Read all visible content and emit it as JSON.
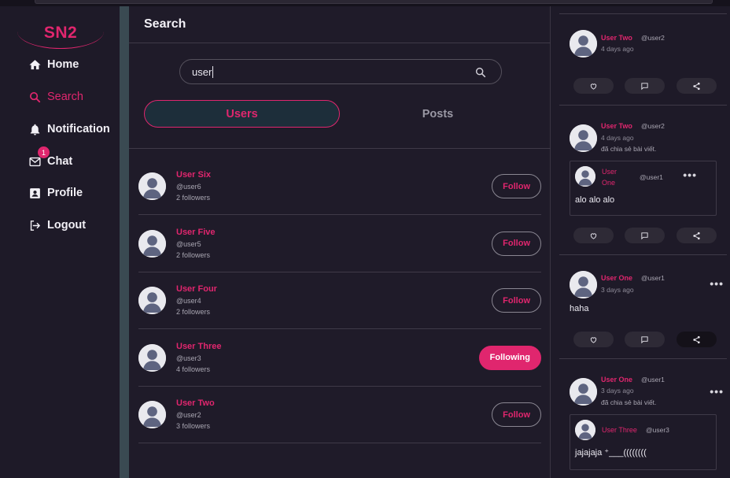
{
  "nav": {
    "logo": "SN2",
    "items": [
      {
        "label": "Home",
        "icon": "home-icon"
      },
      {
        "label": "Search",
        "icon": "search-icon",
        "active": true
      },
      {
        "label": "Notification",
        "icon": "bell-icon"
      },
      {
        "label": "Chat",
        "icon": "mail-icon",
        "badge": "1"
      },
      {
        "label": "Profile",
        "icon": "profile-card-icon"
      },
      {
        "label": "Logout",
        "icon": "logout-icon"
      }
    ]
  },
  "main": {
    "title": "Search",
    "search": {
      "value": "user"
    },
    "tabs": {
      "users": "Users",
      "posts": "Posts"
    },
    "users": [
      {
        "name": "User Six",
        "handle": "@user6",
        "followers": "2 followers",
        "button": "Follow",
        "following": false
      },
      {
        "name": "User Five",
        "handle": "@user5",
        "followers": "2 followers",
        "button": "Follow",
        "following": false
      },
      {
        "name": "User Four",
        "handle": "@user4",
        "followers": "2 followers",
        "button": "Follow",
        "following": false
      },
      {
        "name": "User Three",
        "handle": "@user3",
        "followers": "4 followers",
        "button": "Following",
        "following": true
      },
      {
        "name": "User Two",
        "handle": "@user2",
        "followers": "3 followers",
        "button": "Follow",
        "following": false
      }
    ]
  },
  "feed": {
    "posts": [
      {
        "name": "User Two",
        "handle": "@user2",
        "time": "4 days ago"
      },
      {
        "name": "User Two",
        "handle": "@user2",
        "time": "4 days ago",
        "shared": "đã chia sẻ bài viết.",
        "embed": {
          "name_line1": "User",
          "name_line2": "One",
          "handle": "@user1",
          "text": "alo alo alo"
        }
      },
      {
        "name": "User One",
        "handle": "@user1",
        "time": "3 days ago",
        "text": "haha"
      },
      {
        "name": "User One",
        "handle": "@user1",
        "time": "3 days ago",
        "shared": "đã chia sẻ bài viết.",
        "embed": {
          "name": "User Three",
          "handle": "@user3",
          "text": "jajajaja ⁺___(((((((("
        }
      }
    ]
  },
  "colors": {
    "accent": "#e0266e",
    "background": "#1e1a28",
    "divider": "#3a4a52"
  }
}
